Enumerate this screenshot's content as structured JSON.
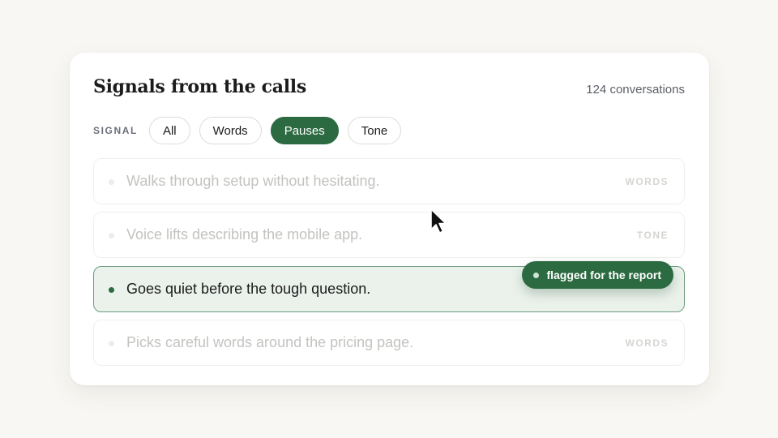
{
  "panel": {
    "title": "Signals from the calls",
    "count": "124 conversations"
  },
  "filter": {
    "label": "SIGNAL",
    "chips": [
      "All",
      "Words",
      "Pauses",
      "Tone"
    ],
    "active": "Pauses"
  },
  "signals": [
    {
      "text": "Walks through setup without hesitating.",
      "tag": "WORDS"
    },
    {
      "text": "Voice lifts describing the mobile app.",
      "tag": "TONE"
    },
    {
      "text": "Goes quiet before the tough question.",
      "flag": "flagged for the report"
    },
    {
      "text": "Picks careful words around the pricing page.",
      "tag": "WORDS"
    }
  ],
  "colors": {
    "accent": "#2c6a41",
    "highlight_bg": "#ebf2ec",
    "background": "#f8f7f3"
  },
  "icons": {
    "cursor": "cursor-arrow-icon"
  }
}
